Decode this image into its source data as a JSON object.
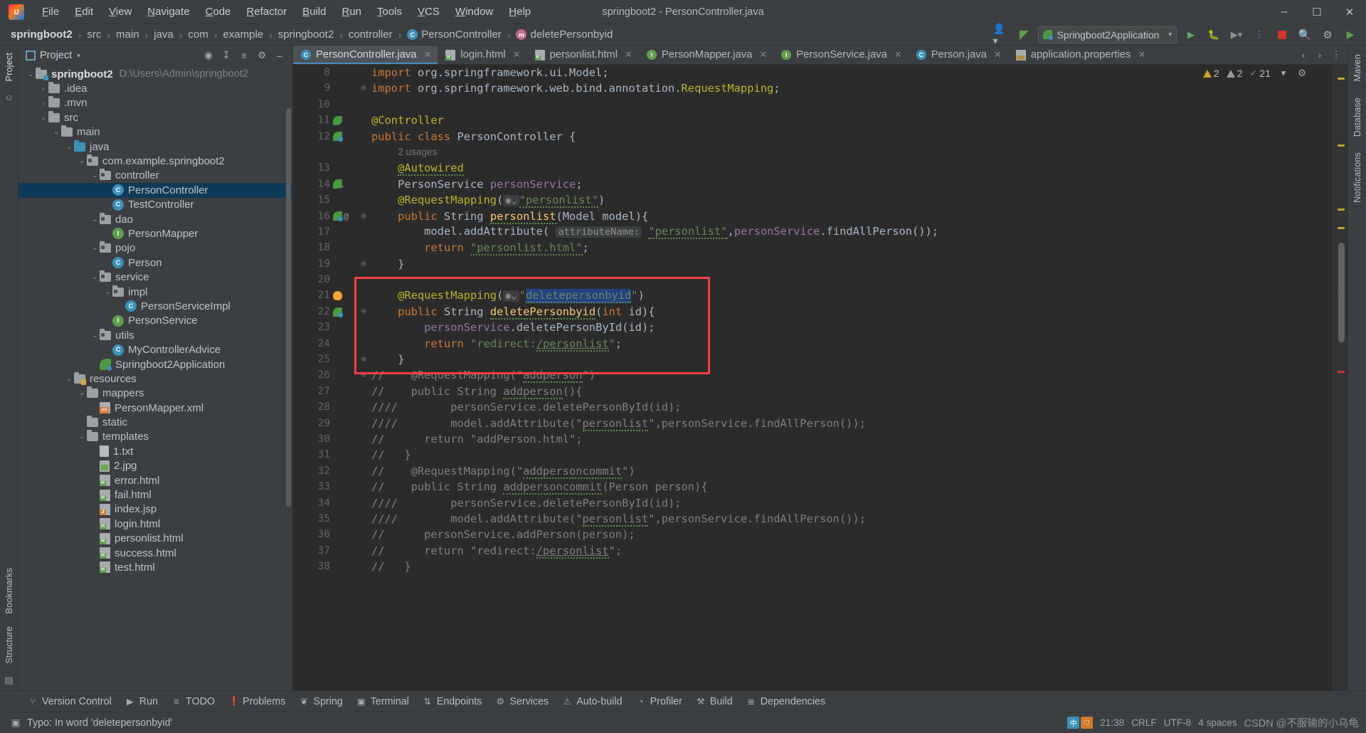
{
  "window": {
    "title": "springboot2 - PersonController.java",
    "logo_icon": "intellij-idea-logo",
    "minimize_icon": "minimize-icon",
    "maximize_icon": "maximize-icon",
    "close_icon": "close-icon"
  },
  "menubar": [
    {
      "label": "File"
    },
    {
      "label": "Edit"
    },
    {
      "label": "View"
    },
    {
      "label": "Navigate"
    },
    {
      "label": "Code"
    },
    {
      "label": "Refactor"
    },
    {
      "label": "Build"
    },
    {
      "label": "Run"
    },
    {
      "label": "Tools"
    },
    {
      "label": "VCS"
    },
    {
      "label": "Window"
    },
    {
      "label": "Help"
    }
  ],
  "breadcrumb": [
    {
      "label": "springboot2",
      "icon": "",
      "bold": true
    },
    {
      "label": "src",
      "icon": ""
    },
    {
      "label": "main",
      "icon": ""
    },
    {
      "label": "java",
      "icon": ""
    },
    {
      "label": "com",
      "icon": ""
    },
    {
      "label": "example",
      "icon": ""
    },
    {
      "label": "springboot2",
      "icon": ""
    },
    {
      "label": "controller",
      "icon": ""
    },
    {
      "label": "PersonController",
      "icon": "class-badge"
    },
    {
      "label": "deletePersonbyid",
      "icon": "method-badge"
    }
  ],
  "toolbar": {
    "account_icon": "user-account-icon",
    "build_icon": "hammer-build-icon",
    "run_config": "Springboot2Application",
    "run_config_icon": "spring-boot-icon",
    "dropdown_icon": "chevron-down-icon",
    "run_icon": "run-play-icon",
    "debug_icon": "debug-bug-icon",
    "coverage_icon": "run-coverage-icon",
    "more_icon": "more-run-icon",
    "stop_icon": "stop-icon",
    "search_icon": "search-everywhere-icon",
    "settings_icon": "settings-gear-icon",
    "updates_icon": "updates-icon"
  },
  "left_rail": {
    "top": [
      "Project"
    ],
    "bottom": [
      "Bookmarks",
      "Structure"
    ]
  },
  "right_rail": {
    "items": [
      "Maven",
      "Database",
      "Notifications"
    ]
  },
  "project_panel": {
    "title": "Project",
    "title_caret": "chevron-down-icon",
    "actions": [
      "select-opened-file-icon",
      "collapse-all-icon",
      "expand-icon",
      "settings-icon",
      "hide-icon"
    ],
    "tree": [
      {
        "indent": 0,
        "twist": "v",
        "icon": "module-folder",
        "label": "springboot2",
        "bold": true,
        "path": "D:\\Users\\Admin\\springboot2"
      },
      {
        "indent": 1,
        "twist": ">",
        "icon": "folder",
        "label": ".idea"
      },
      {
        "indent": 1,
        "twist": ">",
        "icon": "folder",
        "label": ".mvn"
      },
      {
        "indent": 1,
        "twist": "v",
        "icon": "folder",
        "label": "src"
      },
      {
        "indent": 2,
        "twist": "v",
        "icon": "folder",
        "label": "main"
      },
      {
        "indent": 3,
        "twist": "v",
        "icon": "source-folder",
        "label": "java"
      },
      {
        "indent": 4,
        "twist": "v",
        "icon": "package",
        "label": "com.example.springboot2"
      },
      {
        "indent": 5,
        "twist": "v",
        "icon": "package",
        "label": "controller"
      },
      {
        "indent": 6,
        "twist": "",
        "icon": "class",
        "label": "PersonController",
        "selected": true
      },
      {
        "indent": 6,
        "twist": "",
        "icon": "class",
        "label": "TestController"
      },
      {
        "indent": 5,
        "twist": "v",
        "icon": "package",
        "label": "dao"
      },
      {
        "indent": 6,
        "twist": "",
        "icon": "interface",
        "label": "PersonMapper"
      },
      {
        "indent": 5,
        "twist": "v",
        "icon": "package",
        "label": "pojo"
      },
      {
        "indent": 6,
        "twist": "",
        "icon": "class",
        "label": "Person"
      },
      {
        "indent": 5,
        "twist": "v",
        "icon": "package",
        "label": "service"
      },
      {
        "indent": 6,
        "twist": "v",
        "icon": "package",
        "label": "impl"
      },
      {
        "indent": 7,
        "twist": "",
        "icon": "class",
        "label": "PersonServiceImpl"
      },
      {
        "indent": 6,
        "twist": "",
        "icon": "interface",
        "label": "PersonService"
      },
      {
        "indent": 5,
        "twist": "v",
        "icon": "package",
        "label": "utils"
      },
      {
        "indent": 6,
        "twist": "",
        "icon": "class",
        "label": "MyControllerAdvice"
      },
      {
        "indent": 5,
        "twist": "",
        "icon": "spring-app",
        "label": "Springboot2Application"
      },
      {
        "indent": 3,
        "twist": "v",
        "icon": "resource-folder",
        "label": "resources"
      },
      {
        "indent": 4,
        "twist": "v",
        "icon": "folder",
        "label": "mappers"
      },
      {
        "indent": 5,
        "twist": "",
        "icon": "xml",
        "label": "PersonMapper.xml"
      },
      {
        "indent": 4,
        "twist": "",
        "icon": "folder",
        "label": "static"
      },
      {
        "indent": 4,
        "twist": "v",
        "icon": "folder",
        "label": "templates"
      },
      {
        "indent": 5,
        "twist": "",
        "icon": "txt",
        "label": "1.txt"
      },
      {
        "indent": 5,
        "twist": "",
        "icon": "image",
        "label": "2.jpg"
      },
      {
        "indent": 5,
        "twist": "",
        "icon": "html",
        "label": "error.html"
      },
      {
        "indent": 5,
        "twist": "",
        "icon": "html",
        "label": "fail.html"
      },
      {
        "indent": 5,
        "twist": "",
        "icon": "jsp",
        "label": "index.jsp"
      },
      {
        "indent": 5,
        "twist": "",
        "icon": "html",
        "label": "login.html"
      },
      {
        "indent": 5,
        "twist": "",
        "icon": "html",
        "label": "personlist.html"
      },
      {
        "indent": 5,
        "twist": "",
        "icon": "html",
        "label": "success.html"
      },
      {
        "indent": 5,
        "twist": "",
        "icon": "html",
        "label": "test.html"
      }
    ]
  },
  "editor_tabs": [
    {
      "label": "PersonController.java",
      "icon": "java-class-icon",
      "active": true
    },
    {
      "label": "login.html",
      "icon": "html-file-icon",
      "active": false
    },
    {
      "label": "personlist.html",
      "icon": "html-file-icon",
      "active": false
    },
    {
      "label": "PersonMapper.java",
      "icon": "java-interface-icon",
      "active": false
    },
    {
      "label": "PersonService.java",
      "icon": "java-interface-icon",
      "active": false
    },
    {
      "label": "Person.java",
      "icon": "java-class-icon",
      "active": false
    },
    {
      "label": "application.properties",
      "icon": "properties-file-icon",
      "active": false
    }
  ],
  "inspections": {
    "errors": "2",
    "warnings": "2",
    "typos": "21",
    "error_icon": "warning-triangle-icon",
    "warning_icon": "weak-warning-triangle-icon",
    "ok_icon": "checkmark-icon",
    "chevron_icon": "chevron-down-icon"
  },
  "code_lines": [
    {
      "no": "8",
      "gutter": "",
      "fold": "",
      "text_html": "<span class=\"kw\">import</span> <span class=\"pl\">org.springframework.ui.Model</span><span class=\"pl\">;</span>"
    },
    {
      "no": "9",
      "gutter": "",
      "fold": "fold-open",
      "text_html": "<span class=\"kw\">import</span> <span class=\"pl\">org.springframework.web.bind.annotation.</span><span class=\"ann\">RequestMapping</span><span class=\"pl\">;</span>"
    },
    {
      "no": "10",
      "gutter": "",
      "fold": "",
      "text_html": ""
    },
    {
      "no": "11",
      "gutter": "check-leaf",
      "fold": "",
      "text_html": "<span class=\"ann\">@Controller</span>"
    },
    {
      "no": "12",
      "gutter": "spring-bean",
      "fold": "",
      "text_html": "<span class=\"kw\">public class </span><span class=\"pl\">PersonController {</span>"
    },
    {
      "no": "",
      "gutter": "",
      "fold": "",
      "text_html": "    <span class=\"usages\">2 usages</span>"
    },
    {
      "no": "13",
      "gutter": "",
      "fold": "",
      "text_html": "    <span class=\"ann typo\">@Autowired</span>"
    },
    {
      "no": "14",
      "gutter": "bean-arrow",
      "fold": "",
      "text_html": "    <span class=\"pl\">PersonService </span><span class=\"fld\">personService</span><span class=\"pl\">;</span>"
    },
    {
      "no": "15",
      "gutter": "",
      "fold": "",
      "text_html": "    <span class=\"ann\">@RequestMapping</span><span class=\"pl\">(</span><span class=\"hintp\">&#9673;&#8964;</span><span class=\"str typo\">\"personlist\"</span><span class=\"pl\">)</span>"
    },
    {
      "no": "16",
      "gutter": "spring-at",
      "fold": "fold-open",
      "text_html": "    <span class=\"kw\">public </span><span class=\"pl\">String </span><span class=\"fn typo\">personlist</span><span class=\"pl\">(Model model){</span>"
    },
    {
      "no": "17",
      "gutter": "",
      "fold": "",
      "text_html": "        <span class=\"pl\">model.addAttribute(</span> <span class=\"hintp\">attributeName:</span> <span class=\"str typo\">\"personlist\"</span><span class=\"pl\">,</span><span class=\"fld\">personService</span><span class=\"pl\">.findAllPerson());</span>"
    },
    {
      "no": "18",
      "gutter": "",
      "fold": "",
      "text_html": "        <span class=\"kw\">return </span><span class=\"str typo\">\"personlist.html\"</span><span class=\"pl\">;</span>"
    },
    {
      "no": "19",
      "gutter": "",
      "fold": "fold-end",
      "text_html": "    <span class=\"pl\">}</span>"
    },
    {
      "no": "20",
      "gutter": "",
      "fold": "",
      "text_html": ""
    },
    {
      "no": "21",
      "gutter": "bulb",
      "fold": "",
      "text_html": "    <span class=\"ann\">@RequestMapping</span><span class=\"pl\">(</span><span class=\"hintp\">&#9673;&#8964;</span><span class=\"str\">\"</span><span class=\"str typo selhl\">deletepersonbyid</span><span class=\"str\">\"</span><span class=\"pl\">)</span>"
    },
    {
      "no": "22",
      "gutter": "spring-bean",
      "fold": "fold-open",
      "text_html": "    <span class=\"kw\">public </span><span class=\"pl\">String </span><span class=\"fn typo\">deletePersonbyid</span><span class=\"pl\">(</span><span class=\"kw\">int </span><span class=\"pl\">id){</span>"
    },
    {
      "no": "23",
      "gutter": "",
      "fold": "",
      "text_html": "        <span class=\"fld\">personService</span><span class=\"pl\">.deletePersonById(id);</span>"
    },
    {
      "no": "24",
      "gutter": "",
      "fold": "",
      "text_html": "        <span class=\"kw\">return </span><span class=\"str\">\"redirect:</span><span class=\"str typo link-u\">/personlist</span><span class=\"str\">\"</span><span class=\"pl\">;</span>"
    },
    {
      "no": "25",
      "gutter": "",
      "fold": "fold-end",
      "text_html": "    <span class=\"pl\">}</span>"
    },
    {
      "no": "26",
      "gutter": "",
      "fold": "fold-open",
      "text_html": "<span class=\"cm\">//    @RequestMapping(\"</span><span class=\"cm typo\">addperson</span><span class=\"cm\">\")</span>"
    },
    {
      "no": "27",
      "gutter": "",
      "fold": "",
      "text_html": "<span class=\"cm\">//    public String </span><span class=\"cm typo\">addperson</span><span class=\"cm\">(){</span>"
    },
    {
      "no": "28",
      "gutter": "",
      "fold": "",
      "text_html": "<span class=\"cm\">////        personService.deletePersonById(id);</span>"
    },
    {
      "no": "29",
      "gutter": "",
      "fold": "",
      "text_html": "<span class=\"cm\">////        model.addAttribute(\"</span><span class=\"cm typo\">personlist</span><span class=\"cm\">\",personService.findAllPerson());</span>"
    },
    {
      "no": "30",
      "gutter": "",
      "fold": "",
      "text_html": "<span class=\"cm\">//      return \"addPerson.html\";</span>"
    },
    {
      "no": "31",
      "gutter": "",
      "fold": "",
      "text_html": "<span class=\"cm\">//   }</span>"
    },
    {
      "no": "32",
      "gutter": "",
      "fold": "",
      "text_html": "<span class=\"cm\">//    @RequestMapping(\"</span><span class=\"cm typo\">addpersoncommit</span><span class=\"cm\">\")</span>"
    },
    {
      "no": "33",
      "gutter": "",
      "fold": "",
      "text_html": "<span class=\"cm\">//    public String </span><span class=\"cm typo\">addpersoncommit</span><span class=\"cm\">(Person person){</span>"
    },
    {
      "no": "34",
      "gutter": "",
      "fold": "",
      "text_html": "<span class=\"cm\">////        personService.deletePersonById(id);</span>"
    },
    {
      "no": "35",
      "gutter": "",
      "fold": "",
      "text_html": "<span class=\"cm\">////        model.addAttribute(\"</span><span class=\"cm typo\">personlist</span><span class=\"cm\">\",personService.findAllPerson());</span>"
    },
    {
      "no": "36",
      "gutter": "",
      "fold": "",
      "text_html": "<span class=\"cm\">//      personService.addPerson(person);</span>"
    },
    {
      "no": "37",
      "gutter": "",
      "fold": "",
      "text_html": "<span class=\"cm\">//      return \"redirect:</span><span class=\"cm typo link-u\">/personlist</span><span class=\"cm\">\";</span>"
    },
    {
      "no": "38",
      "gutter": "",
      "fold": "",
      "text_html": "<span class=\"cm\">//   }</span>"
    }
  ],
  "tool_windows": [
    {
      "label": "Version Control",
      "icon": "branch-icon"
    },
    {
      "label": "Run",
      "icon": "run-icon"
    },
    {
      "label": "TODO",
      "icon": "todo-list-icon"
    },
    {
      "label": "Problems",
      "icon": "problems-icon"
    },
    {
      "label": "Spring",
      "icon": "spring-leaf-icon"
    },
    {
      "label": "Terminal",
      "icon": "terminal-icon"
    },
    {
      "label": "Endpoints",
      "icon": "endpoints-icon"
    },
    {
      "label": "Services",
      "icon": "services-icon"
    },
    {
      "label": "Auto-build",
      "icon": "auto-build-icon"
    },
    {
      "label": "Profiler",
      "icon": "profiler-icon"
    },
    {
      "label": "Build",
      "icon": "build-hammer-icon"
    },
    {
      "label": "Dependencies",
      "icon": "dependencies-icon"
    }
  ],
  "statusbar": {
    "message": "Typo: In word 'deletepersonbyid'",
    "message_icon": "inspection-icon",
    "ime": {
      "left": "中",
      "right": "□"
    },
    "position": "21:38",
    "line_sep": "CRLF",
    "encoding": "UTF-8",
    "indent": "4 spaces",
    "watermark": "CSDN @不服输的小乌龟"
  }
}
